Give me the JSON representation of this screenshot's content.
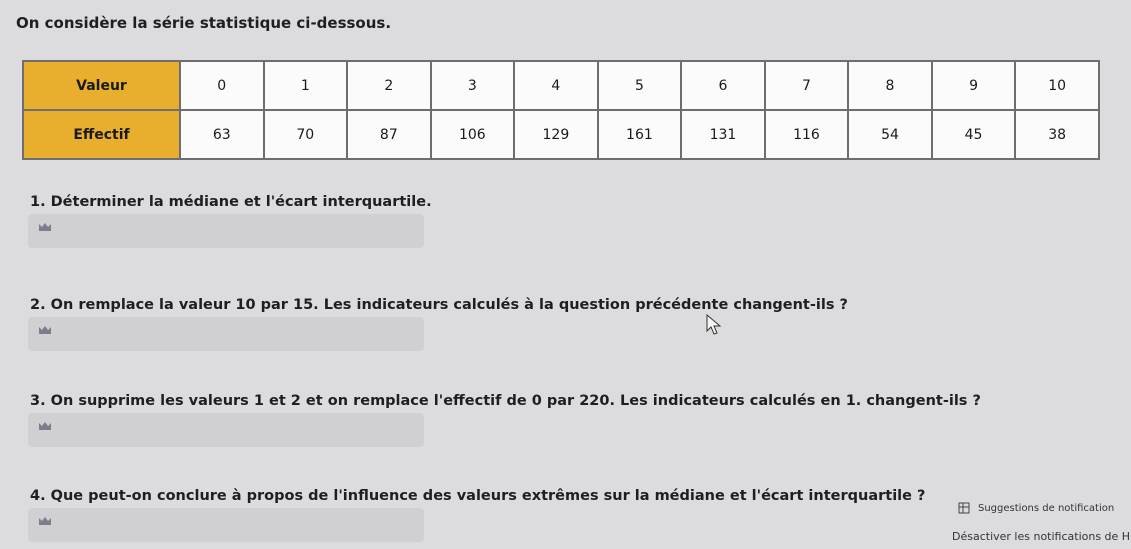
{
  "intro": "On considère la série statistique ci-dessous.",
  "table": {
    "row_headers": [
      "Valeur",
      "Effectif"
    ],
    "valeurs": [
      "0",
      "1",
      "2",
      "3",
      "4",
      "5",
      "6",
      "7",
      "8",
      "9",
      "10"
    ],
    "effectifs": [
      "63",
      "70",
      "87",
      "106",
      "129",
      "161",
      "131",
      "116",
      "54",
      "45",
      "38"
    ]
  },
  "questions": [
    "1. Déterminer la médiane et l'écart interquartile.",
    "2. On remplace la valeur 10 par 15. Les indicateurs calculés à la question précédente changent-ils ?",
    "3. On supprime les valeurs 1 et 2 et on remplace l'effectif de 0 par 220. Les indicateurs calculés en 1. changent-ils ?",
    "4. Que peut-on conclure à propos de l'influence des valeurs extrêmes sur la médiane et l'écart interquartile ?"
  ],
  "notifications": {
    "suggestions": "Suggestions de notification",
    "deactivate": "Désactiver les notifications de HP"
  },
  "icons": {
    "answer_marker": "crown-icon",
    "notification": "notification-settings-icon",
    "cursor": "mouse-pointer-icon"
  }
}
